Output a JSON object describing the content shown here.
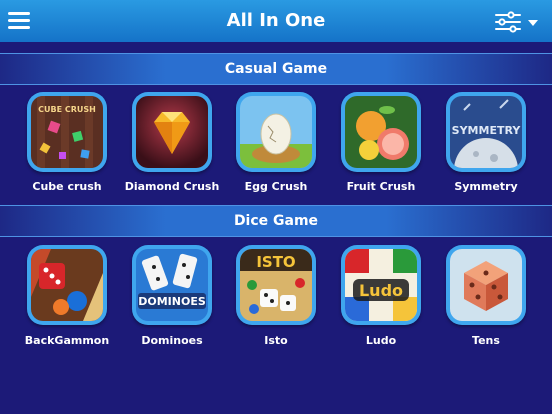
{
  "header": {
    "title": "All In One",
    "menu_icon": "hamburger-menu-icon",
    "filter_icon": "sliders-filter-icon"
  },
  "sections": [
    {
      "title": "Casual Game",
      "games": [
        {
          "label": "Cube crush",
          "art_text": "CUBE CRUSH"
        },
        {
          "label": "Diamond Crush"
        },
        {
          "label": "Egg Crush"
        },
        {
          "label": "Fruit Crush"
        },
        {
          "label": "Symmetry",
          "art_text": "SYMMETRY"
        }
      ]
    },
    {
      "title": "Dice Game",
      "games": [
        {
          "label": "BackGammon"
        },
        {
          "label": "Dominoes",
          "art_text": "DOMINOES"
        },
        {
          "label": "Isto",
          "art_text": "ISTO"
        },
        {
          "label": "Ludo",
          "art_text": "Ludo"
        },
        {
          "label": "Tens"
        }
      ]
    }
  ],
  "colors": {
    "background": "#1c1a78",
    "header": "#1a86d8",
    "tile_border": "#3fa6ee",
    "section_bar": "#2a6fd0"
  }
}
